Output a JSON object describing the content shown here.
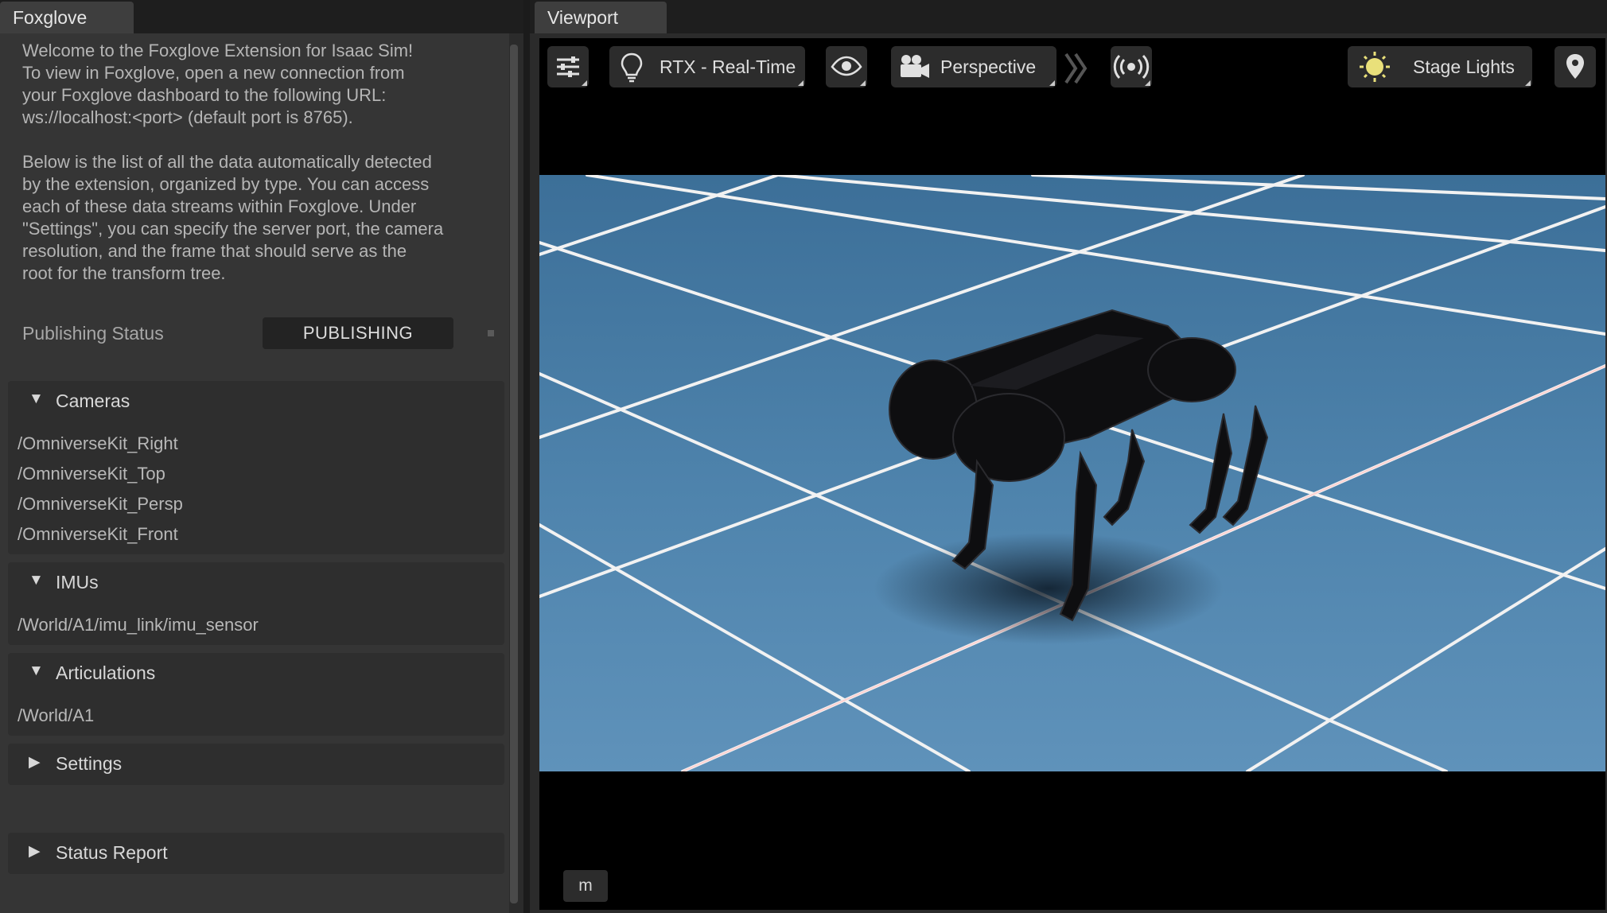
{
  "foxglove_panel": {
    "tab_title": "Foxglove",
    "intro": "Welcome to the Foxglove Extension for Isaac Sim!\nTo view in Foxglove, open a new connection from\nyour Foxglove dashboard to the following URL:\nws://localhost:<port> (default port is 8765).",
    "description": "Below is the list of all the data automatically detected\nby the extension, organized by type. You can access\neach of these data streams within Foxglove. Under\n\"Settings\", you can specify the server port, the camera\nresolution, and the frame that should serve as the\nroot for the transform tree.",
    "status_label": "Publishing Status",
    "status_value": "PUBLISHING",
    "sections": {
      "cameras": {
        "title": "Cameras",
        "arrow": "▼",
        "items": [
          "/OmniverseKit_Right",
          "/OmniverseKit_Top",
          "/OmniverseKit_Persp",
          "/OmniverseKit_Front"
        ]
      },
      "imus": {
        "title": "IMUs",
        "arrow": "▼",
        "items": [
          "/World/A1/imu_link/imu_sensor"
        ]
      },
      "articulations": {
        "title": "Articulations",
        "arrow": "▼",
        "items": [
          "/World/A1"
        ]
      },
      "settings": {
        "title": "Settings",
        "arrow": "▶"
      },
      "status_report": {
        "title": "Status Report",
        "arrow": "▶"
      }
    }
  },
  "viewport": {
    "tab_title": "Viewport",
    "toolbar": {
      "renderer_label": "RTX - Real-Time",
      "camera_label": "Perspective",
      "lights_label": "Stage Lights"
    },
    "unit_label": "m",
    "colors": {
      "floor": "#4a7ea6",
      "grid_line": "#f2f2f2",
      "robot": "#0e0e10",
      "light_icon": "#e9e07a"
    },
    "icons": {
      "settings": "sliders-icon",
      "renderer": "lightbulb-icon",
      "visibility": "eye-icon",
      "camera": "video-camera-icon",
      "expand": "chevron-right-double-icon",
      "live": "broadcast-icon",
      "lights": "sun-icon",
      "pin": "location-pin-icon"
    }
  }
}
